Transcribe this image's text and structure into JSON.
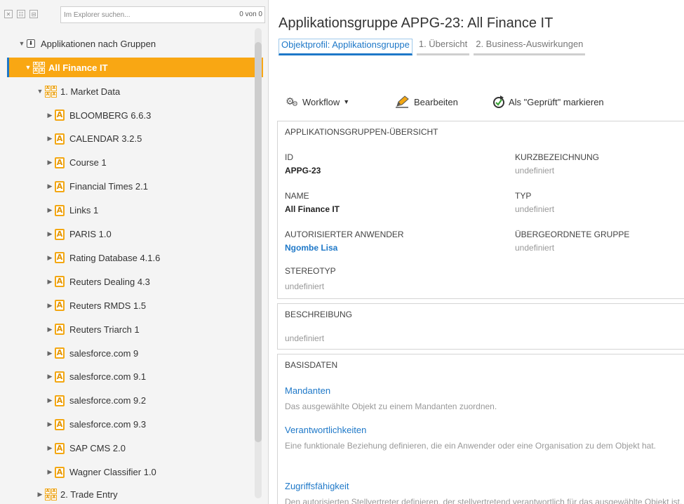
{
  "explorer": {
    "search_placeholder": "Im Explorer suchen...",
    "result_count": "0 von 0",
    "toolbar_buttons": [
      "collapse-all-icon",
      "expand-all-icon",
      "tree-icon"
    ],
    "root_label": "Applikationen nach Gruppen",
    "selected_group": "All Finance IT",
    "subgroup_1": "1. Market Data",
    "applications": [
      "BLOOMBERG 6.6.3",
      "CALENDAR 3.2.5",
      "Course 1",
      "Financial Times 2.1",
      "Links 1",
      "PARIS 1.0",
      "Rating Database 4.1.6",
      "Reuters Dealing 4.3",
      "Reuters RMDS 1.5",
      "Reuters Triarch 1",
      "salesforce.com 9",
      "salesforce.com 9.1",
      "salesforce.com 9.2",
      "salesforce.com 9.3",
      "SAP CMS 2.0",
      "Wagner Classifier 1.0"
    ],
    "subgroup_2": "2. Trade Entry",
    "app_icon_letter": "A",
    "group_icon_letters": [
      "A",
      "A",
      "A",
      "A"
    ]
  },
  "main": {
    "title": "Applikationsgruppe APPG-23: All Finance IT",
    "tabs": [
      "Objektprofil: Applikationsgruppe",
      "1. Übersicht",
      "2. Business-Auswirkungen"
    ],
    "actions": {
      "workflow": "Workflow",
      "edit": "Bearbeiten",
      "mark_checked": "Als \"Geprüft\" markieren"
    },
    "overview": {
      "heading": "APPLIKATIONSGRUPPEN-ÜBERSICHT",
      "id_label": "ID",
      "id_value": "APPG-23",
      "short_label": "KURZBEZEICHNUNG",
      "short_value": "undefiniert",
      "name_label": "NAME",
      "name_value": "All Finance IT",
      "type_label": "TYP",
      "type_value": "undefiniert",
      "user_label": "AUTORISIERTER ANWENDER",
      "user_value": "Ngombe Lisa",
      "parent_label": "ÜBERGEORDNETE GRUPPE",
      "parent_value": "undefiniert",
      "stereo_label": "STEREOTYP",
      "stereo_value": "undefiniert"
    },
    "description": {
      "heading": "BESCHREIBUNG",
      "value": "undefiniert"
    },
    "basisdaten": {
      "heading": "BASISDATEN",
      "mandanten_link": "Mandanten",
      "mandanten_desc": "Das ausgewählte Objekt zu einem Mandanten zuordnen.",
      "verant_link": "Verantwortlichkeiten",
      "verant_desc": "Eine funktionale Beziehung definieren, die ein Anwender oder eine Organisation zu dem Objekt hat.",
      "zugriff_link": "Zugriffsfähigkeit",
      "zugriff_desc": "Den autorisierten Stellvertreter definieren, der stellvertretend verantwortlich für das ausgewählte Objekt ist."
    }
  },
  "colors": {
    "accent_blue": "#1e78c8",
    "selection_orange": "#f9a713",
    "icon_orange": "#f3a712"
  }
}
